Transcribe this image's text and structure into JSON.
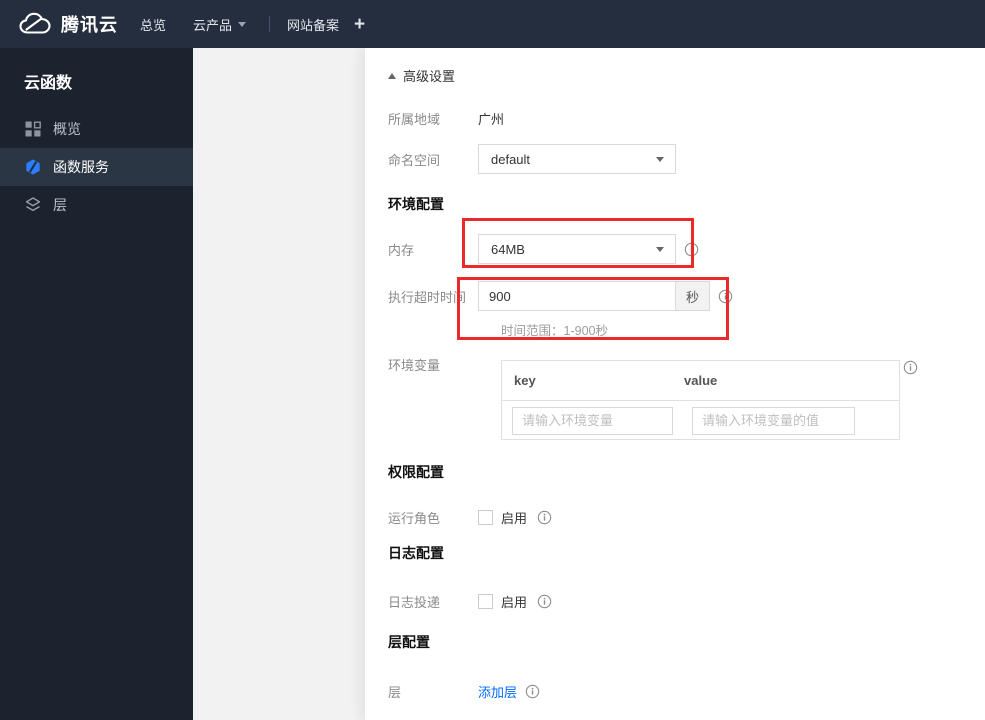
{
  "colors": {
    "accent_blue": "#006eff",
    "annotation_red": "#e82a2a",
    "topbar_bg": "#252e3e",
    "sidebar_bg": "#1c222e",
    "sidebar_selected_bg": "#2b3645",
    "overlay_gray": "#f2f2f2"
  },
  "topbar": {
    "brand": "腾讯云",
    "logo_icon": "tencent-cloud-logo-icon",
    "items": [
      {
        "label": "总览"
      },
      {
        "label": "云产品",
        "has_caret": true
      },
      {
        "label": "网站备案"
      },
      {
        "label": "+"
      }
    ]
  },
  "sidebar": {
    "title": "云函数",
    "items": [
      {
        "label": "概览",
        "icon": "grid-icon",
        "selected": false
      },
      {
        "label": "函数服务",
        "icon": "scf-hexagon-icon",
        "selected": true
      },
      {
        "label": "层",
        "icon": "layers-icon",
        "selected": false
      }
    ]
  },
  "form": {
    "advanced_toggle": "高级设置",
    "section_headers": {
      "env": "环境配置",
      "perm": "权限配置",
      "log": "日志配置",
      "layer": "层配置"
    },
    "rows": {
      "region": {
        "label": "所属地域",
        "value": "广州"
      },
      "namespace": {
        "label": "命名空间",
        "value": "default"
      },
      "memory": {
        "label": "内存",
        "value": "64MB",
        "info_icon": "info-icon"
      },
      "timeout": {
        "label": "执行超时时间",
        "value": "900",
        "unit": "秒",
        "hint": "时间范围：1-900秒",
        "info_icon": "info-icon"
      },
      "env_vars": {
        "label": "环境变量",
        "key_header": "key",
        "value_header": "value",
        "key_placeholder": "请输入环境变量",
        "value_placeholder": "请输入环境变量的值",
        "info_icon": "info-icon"
      },
      "role": {
        "label": "运行角色",
        "checkbox_label": "启用",
        "checked": false,
        "info_icon": "info-icon"
      },
      "log_delivery": {
        "label": "日志投递",
        "checkbox_label": "启用",
        "checked": false,
        "info_icon": "info-icon"
      },
      "layer": {
        "label": "层",
        "link_label": "添加层",
        "info_icon": "info-icon"
      }
    }
  }
}
